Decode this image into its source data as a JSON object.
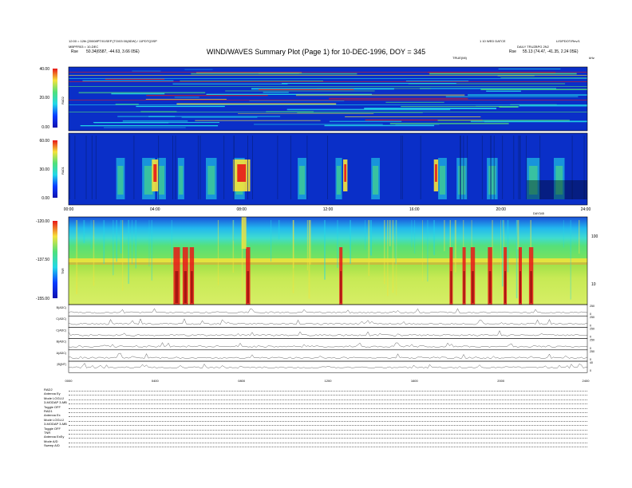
{
  "header": {
    "title": "WIND/WAVES Summary Plot (Page 1) for 10-DEC-1996, DOY = 345",
    "left_line1": "12:00 = 12th [20008PT/01SEP [TO/03 00(8DW) / 11PDTQ3SP",
    "left_line2": "MBPFR03 = 10-DEC",
    "left_line3": "50.34(6587, -44.63, 3.66 05E)",
    "left_rse": "Rse",
    "right_line1": "1 10 WED DATCE",
    "right_line1b": "LIS/PDOT/Rev/1",
    "right_line2": "DAILY TRUZBPG 2N2",
    "right_line3": "55.13 (74.47, -41.35, 2.24 05E)",
    "right_rse": "Rse",
    "center_label": "TRUE(MI)",
    "right_unit": "kHz"
  },
  "colors": {
    "bg_blue": "#0a2fc8",
    "mid_cyan": "#22d8e8",
    "green": "#4fe07a",
    "yellow": "#f5e33b",
    "red": "#e81818",
    "dark_red": "#8e0a0a"
  },
  "chart_data": [
    {
      "type": "heatmap",
      "name": "RAD2",
      "colorbar_ticks": [
        "40.00",
        "20.00",
        "0.00"
      ],
      "ylabel": "RAD2",
      "clim": [
        0,
        40
      ]
    },
    {
      "type": "heatmap",
      "name": "RAD1",
      "colorbar_ticks": [
        "60.00",
        "30.00",
        "0.00"
      ],
      "ylabel": "RAD1",
      "clim": [
        0,
        60
      ],
      "x_ticks": [
        "00:00",
        "04:00",
        "08:00",
        "12:00",
        "16:00",
        "20:00",
        "24:00"
      ],
      "time_label": "DAY345"
    },
    {
      "type": "heatmap",
      "name": "TNR",
      "colorbar_ticks": [
        "-120.00",
        "-137.50",
        "-155.00"
      ],
      "ylabel": "TNR",
      "clim": [
        -155,
        -120
      ],
      "right_ticks": [
        "100",
        "10"
      ]
    },
    {
      "type": "line",
      "panels": [
        {
          "label": "B(ADC)",
          "right_ticks": [
            "250",
            "0"
          ]
        },
        {
          "label": "C(ADC)",
          "right_ticks": [
            "250",
            "0"
          ]
        },
        {
          "label": "C(ADC)",
          "right_ticks": [
            "250",
            "0"
          ]
        },
        {
          "label": "B(ADC)",
          "right_ticks": [
            "250",
            "0"
          ]
        },
        {
          "label": "A(ADC)",
          "right_ticks": [
            "250",
            "0"
          ]
        },
        {
          "label": "|B|(NT)",
          "right_ticks": [
            "40",
            "0"
          ]
        }
      ],
      "x_ticks": [
        "0000",
        "0400",
        "0800",
        "1200",
        "1600",
        "2000",
        "2400"
      ]
    }
  ],
  "footer": {
    "rows": [
      {
        "label": "RAD2"
      },
      {
        "label": "Antenna",
        "value": "Ey"
      },
      {
        "label": "Mode",
        "value": "LOGLIJ"
      },
      {
        "label": "3-MODAP",
        "value": "3-MB"
      },
      {
        "label": "Toggle",
        "value": "OFF"
      },
      {
        "label": "RAD1"
      },
      {
        "label": "Antenna",
        "value": "Ex"
      },
      {
        "label": "Mode",
        "value": "LOGLIJ"
      },
      {
        "label": "3-MODAP",
        "value": "3-MB"
      },
      {
        "label": "Toggle",
        "value": "OFF"
      },
      {
        "label": "TNR"
      },
      {
        "label": "Antenna",
        "value": "ExEy"
      },
      {
        "label": "Mode",
        "value": "A/D"
      },
      {
        "label": "Sweep",
        "value": "A/D"
      }
    ]
  }
}
